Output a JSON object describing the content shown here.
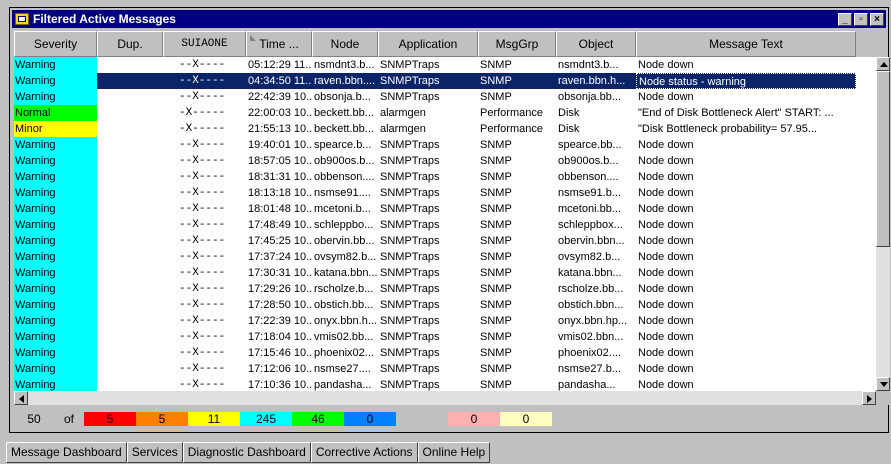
{
  "window": {
    "title": "Filtered Active Messages",
    "buttons": [
      "_",
      "▫",
      "×"
    ]
  },
  "columns": [
    {
      "key": "severity",
      "label": "Severity",
      "w": 83,
      "mono": false
    },
    {
      "key": "dup",
      "label": "Dup.",
      "w": 66,
      "mono": false
    },
    {
      "key": "suiaone",
      "label": "SUIAONE",
      "w": 83,
      "mono": true
    },
    {
      "key": "time",
      "label": "Time ...",
      "w": 66,
      "mono": false,
      "sorted": true
    },
    {
      "key": "node",
      "label": "Node",
      "w": 66,
      "mono": false
    },
    {
      "key": "application",
      "label": "Application",
      "w": 100,
      "mono": false
    },
    {
      "key": "msggrp",
      "label": "MsgGrp",
      "w": 78,
      "mono": false
    },
    {
      "key": "object",
      "label": "Object",
      "w": 80,
      "mono": false
    },
    {
      "key": "message",
      "label": "Message Text",
      "w": 220,
      "mono": false
    }
  ],
  "severity_colors": {
    "Warning": "#00ffff",
    "Normal": "#00ff00",
    "Minor": "#ffff00"
  },
  "selection_color": "#0a246a",
  "rows": [
    [
      "Warning",
      "",
      "--X----",
      "05:12:29 11...",
      "nsmdnt3.b...",
      "SNMPTraps",
      "SNMP",
      "nsmdnt3.b...",
      "Node down"
    ],
    [
      "Warning",
      "",
      "--X----",
      "04:34:50 11...",
      "raven.bbn....",
      "SNMPTraps",
      "SNMP",
      "raven.bbn.h...",
      "Node status - warning"
    ],
    [
      "Warning",
      "",
      "--X----",
      "22:42:39 10...",
      "obsonja.b...",
      "SNMPTraps",
      "SNMP",
      "obsonja.bb...",
      "Node down"
    ],
    [
      "Normal",
      "",
      "-X-----",
      "22:00:03 10...",
      "beckett.bb...",
      "alarmgen",
      "Performance",
      "Disk",
      "\"End of Disk Bottleneck Alert\" START: ..."
    ],
    [
      "Minor",
      "",
      "-X-----",
      "21:55:13 10...",
      "beckett.bb...",
      "alarmgen",
      "Performance",
      "Disk",
      "\"Disk Bottleneck probability=   57.95..."
    ],
    [
      "Warning",
      "",
      "--X----",
      "19:40:01 10...",
      "spearce.b...",
      "SNMPTraps",
      "SNMP",
      "spearce.bb...",
      "Node down"
    ],
    [
      "Warning",
      "",
      "--X----",
      "18:57:05 10...",
      "ob900os.b...",
      "SNMPTraps",
      "SNMP",
      "ob900os.b...",
      "Node down"
    ],
    [
      "Warning",
      "",
      "--X----",
      "18:31:31 10...",
      "obbenson....",
      "SNMPTraps",
      "SNMP",
      "obbenson....",
      "Node down"
    ],
    [
      "Warning",
      "",
      "--X----",
      "18:13:18 10...",
      "nsmse91....",
      "SNMPTraps",
      "SNMP",
      "nsmse91.b...",
      "Node down"
    ],
    [
      "Warning",
      "",
      "--X----",
      "18:01:48 10...",
      "mcetoni.b...",
      "SNMPTraps",
      "SNMP",
      "mcetoni.bb...",
      "Node down"
    ],
    [
      "Warning",
      "",
      "--X----",
      "17:48:49 10...",
      "schleppbo...",
      "SNMPTraps",
      "SNMP",
      "schleppbox...",
      "Node down"
    ],
    [
      "Warning",
      "",
      "--X----",
      "17:45:25 10...",
      "obervin.bb...",
      "SNMPTraps",
      "SNMP",
      "obervin.bbn...",
      "Node down"
    ],
    [
      "Warning",
      "",
      "--X----",
      "17:37:24 10...",
      "ovsym82.b...",
      "SNMPTraps",
      "SNMP",
      "ovsym82.b...",
      "Node down"
    ],
    [
      "Warning",
      "",
      "--X----",
      "17:30:31 10...",
      "katana.bbn...",
      "SNMPTraps",
      "SNMP",
      "katana.bbn...",
      "Node down"
    ],
    [
      "Warning",
      "",
      "--X----",
      "17:29:26 10...",
      "rscholze.b...",
      "SNMPTraps",
      "SNMP",
      "rscholze.bb...",
      "Node down"
    ],
    [
      "Warning",
      "",
      "--X----",
      "17:28:50 10...",
      "obstich.bb...",
      "SNMPTraps",
      "SNMP",
      "obstich.bbn...",
      "Node down"
    ],
    [
      "Warning",
      "",
      "--X----",
      "17:22:39 10...",
      "onyx.bbn.h...",
      "SNMPTraps",
      "SNMP",
      "onyx.bbn.hp...",
      "Node down"
    ],
    [
      "Warning",
      "",
      "--X----",
      "17:18:04 10...",
      "vmis02.bb...",
      "SNMPTraps",
      "SNMP",
      "vmis02.bbn...",
      "Node down"
    ],
    [
      "Warning",
      "",
      "--X----",
      "17:15:46 10...",
      "phoenix02...",
      "SNMPTraps",
      "SNMP",
      "phoenix02....",
      "Node down"
    ],
    [
      "Warning",
      "",
      "--X----",
      "17:12:06 10...",
      "nsmse27....",
      "SNMPTraps",
      "SNMP",
      "nsmse27.b...",
      "Node down"
    ],
    [
      "Warning",
      "",
      "--X----",
      "17:10:36 10...",
      "pandasha...",
      "SNMPTraps",
      "SNMP",
      "pandasha...",
      "Node down"
    ]
  ],
  "selected_row": 1,
  "status": {
    "total": "50",
    "of_label": "of",
    "counts": [
      {
        "value": "5",
        "color": "#ff0000",
        "w": 52
      },
      {
        "value": "5",
        "color": "#ff8000",
        "w": 52
      },
      {
        "value": "11",
        "color": "#ffff00",
        "w": 52
      },
      {
        "value": "245",
        "color": "#00ffff",
        "w": 52
      },
      {
        "value": "46",
        "color": "#00ff00",
        "w": 52
      },
      {
        "value": "0",
        "color": "#0080ff",
        "w": 52
      },
      {
        "value": "",
        "color": "#c0c0c0",
        "w": 52
      },
      {
        "value": "0",
        "color": "#ffb0b0",
        "w": 52
      },
      {
        "value": "0",
        "color": "#ffffc0",
        "w": 52
      }
    ]
  },
  "tabs": [
    {
      "label": "Message Dashboard",
      "active": true
    },
    {
      "label": "Services",
      "active": false
    },
    {
      "label": "Diagnostic Dashboard",
      "active": false
    },
    {
      "label": "Corrective Actions",
      "active": false
    },
    {
      "label": "Online Help",
      "active": false
    }
  ]
}
